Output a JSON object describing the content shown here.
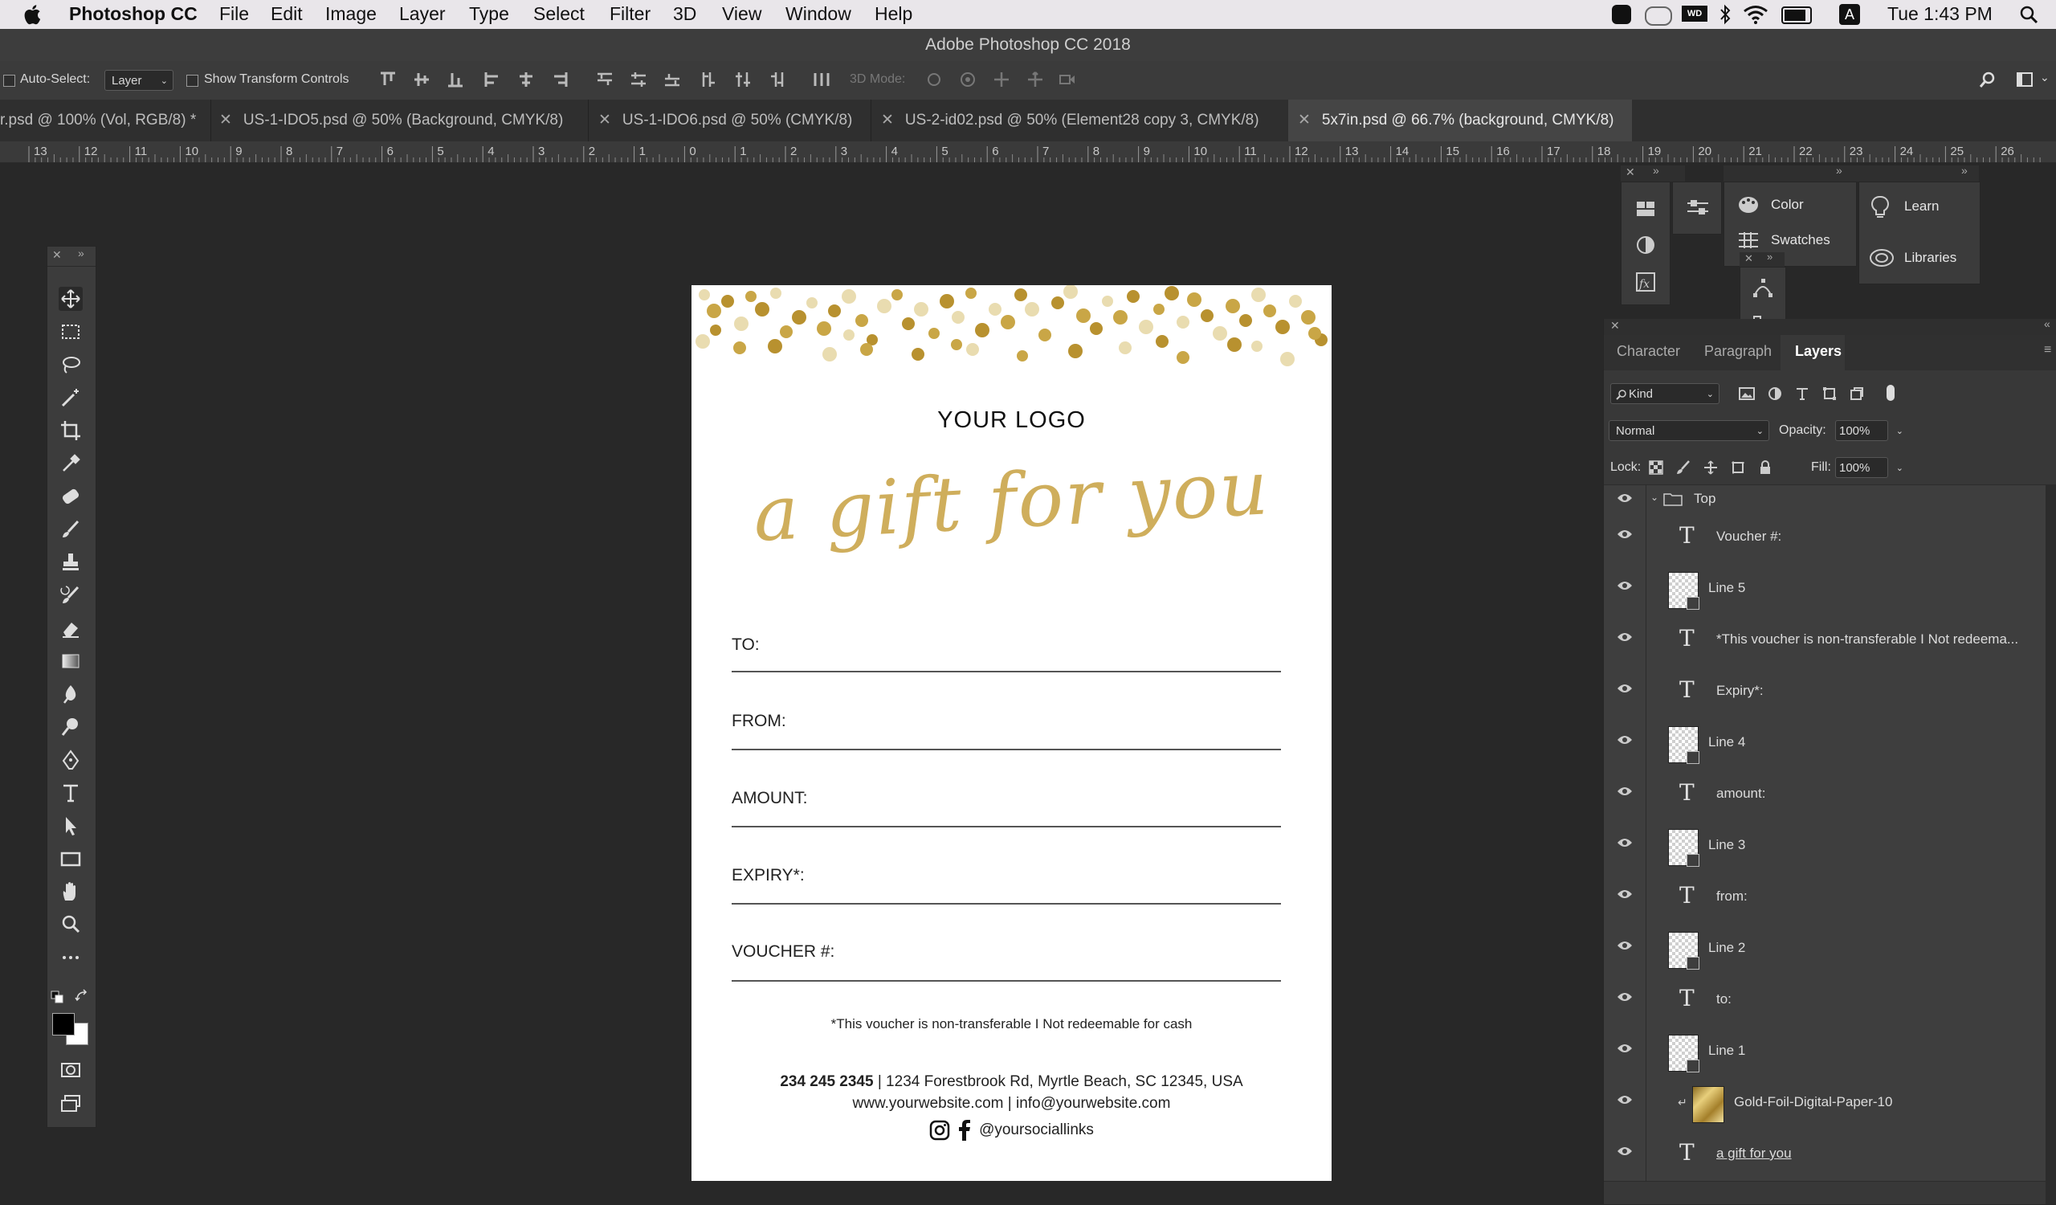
{
  "menubar": {
    "apple": "",
    "app_name": "Photoshop CC",
    "items": [
      "File",
      "Edit",
      "Image",
      "Layer",
      "Type",
      "Select",
      "Filter",
      "3D",
      "View",
      "Window",
      "Help"
    ],
    "status": {
      "clock": "Tue 1:43 PM"
    }
  },
  "window": {
    "title": "Adobe Photoshop CC 2018"
  },
  "options": {
    "auto_select_label": "Auto-Select:",
    "auto_select_value": "Layer",
    "show_transform_label": "Show Transform Controls",
    "mode3d_label": "3D Mode:"
  },
  "tabs": [
    {
      "label": "r.psd @ 100% (Vol, RGB/8) *",
      "active": false
    },
    {
      "label": "US-1-IDO5.psd @ 50% (Background, CMYK/8)",
      "active": false
    },
    {
      "label": "US-1-IDO6.psd @ 50% (CMYK/8)",
      "active": false
    },
    {
      "label": "US-2-id02.psd @ 50% (Element28 copy 3, CMYK/8)",
      "active": false
    },
    {
      "label": "5x7in.psd @ 66.7% (background, CMYK/8)",
      "active": true
    }
  ],
  "ruler": {
    "labels": [
      "13",
      "12",
      "11",
      "10",
      "9",
      "8",
      "7",
      "6",
      "5",
      "4",
      "3",
      "2",
      "1",
      "0",
      "1",
      "2",
      "3",
      "4",
      "5",
      "6",
      "7",
      "8",
      "9",
      "10",
      "11",
      "12",
      "13",
      "14",
      "15",
      "16",
      "17",
      "18",
      "19",
      "20",
      "21",
      "22",
      "23",
      "24",
      "25",
      "26"
    ]
  },
  "document": {
    "logo": "YOUR LOGO",
    "headline": "a gift for you",
    "fields": [
      "TO:",
      "FROM:",
      "AMOUNT:",
      "EXPIRY*:",
      "VOUCHER #:"
    ],
    "disclaimer": "*This voucher is non-transferable I Not redeemable for cash",
    "phone": "234 245 2345",
    "address": " | 1234 Forestbrook Rd, Myrtle Beach, SC 12345, USA",
    "web_line": "www.yourwebsite.com | info@yourwebsite.com",
    "social": "@yoursociallinks",
    "gold": "#c9a646"
  },
  "mini_panels": {
    "color": "Color",
    "swatches": "Swatches",
    "learn": "Learn",
    "libraries": "Libraries"
  },
  "layers_panel": {
    "tabs": [
      "Character",
      "Paragraph",
      "Layers"
    ],
    "active_tab": "Layers",
    "filter_kind": "Kind",
    "blend_mode": "Normal",
    "opacity_label": "Opacity:",
    "opacity_value": "100%",
    "lock_label": "Lock:",
    "fill_label": "Fill:",
    "fill_value": "100%",
    "group_name": "Top",
    "layers": [
      {
        "name": "Voucher #:",
        "kind": "text"
      },
      {
        "name": "Line 5",
        "kind": "shape"
      },
      {
        "name": "*This voucher is non-transferable I Not redeema...",
        "kind": "text"
      },
      {
        "name": "Expiry*:",
        "kind": "text"
      },
      {
        "name": "Line 4",
        "kind": "shape"
      },
      {
        "name": "amount:",
        "kind": "text"
      },
      {
        "name": "Line 3",
        "kind": "shape"
      },
      {
        "name": "from:",
        "kind": "text"
      },
      {
        "name": "Line 2",
        "kind": "shape"
      },
      {
        "name": "to:",
        "kind": "text"
      },
      {
        "name": "Line 1",
        "kind": "shape"
      },
      {
        "name": "Gold-Foil-Digital-Paper-10",
        "kind": "image"
      },
      {
        "name": "a gift for you",
        "kind": "text"
      }
    ]
  }
}
